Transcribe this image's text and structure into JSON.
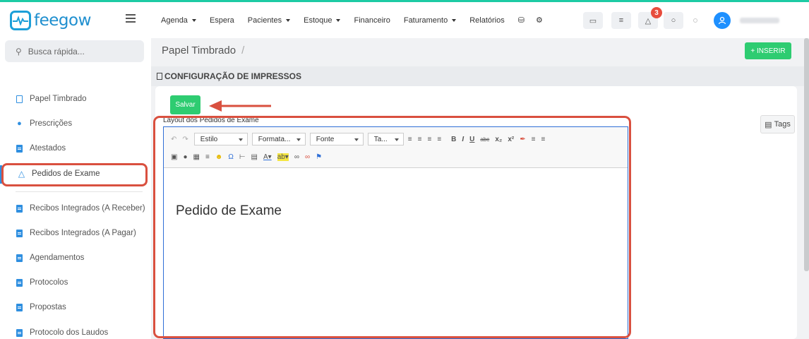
{
  "app": {
    "brand": "feegow"
  },
  "nav": {
    "items": [
      {
        "label": "Agenda",
        "dropdown": true
      },
      {
        "label": "Espera",
        "dropdown": false
      },
      {
        "label": "Pacientes",
        "dropdown": true
      },
      {
        "label": "Estoque",
        "dropdown": true
      },
      {
        "label": "Financeiro",
        "dropdown": false
      },
      {
        "label": "Faturamento",
        "dropdown": true
      },
      {
        "label": "Relatórios",
        "dropdown": false
      }
    ],
    "notification_count": "3"
  },
  "sidebar": {
    "search_placeholder": "Busca rápida...",
    "items": [
      {
        "label": "Papel Timbrado",
        "icon": "document-icon"
      },
      {
        "label": "Prescrições",
        "icon": "pills-icon"
      },
      {
        "label": "Atestados",
        "icon": "document-plus-icon"
      },
      {
        "label": "Pedidos de Exame",
        "icon": "flask-icon"
      },
      {
        "label": "Recibos Integrados (A Receber)",
        "icon": "document-icon"
      },
      {
        "label": "Recibos Integrados (A Pagar)",
        "icon": "document-icon"
      },
      {
        "label": "Agendamentos",
        "icon": "document-icon"
      },
      {
        "label": "Protocolos",
        "icon": "document-icon"
      },
      {
        "label": "Propostas",
        "icon": "document-icon"
      },
      {
        "label": "Protocolo dos Laudos",
        "icon": "document-icon"
      }
    ]
  },
  "main": {
    "breadcrumb": "Papel Timbrado",
    "breadcrumb_sep": "/",
    "insert_label": "+ INSERIR",
    "section_title": "CONFIGURAÇÃO DE IMPRESSOS",
    "save_label": "Salvar",
    "field_label": "Layout dos Pedidos de Exame",
    "tags_label": "Tags",
    "editor": {
      "combos": [
        "Estilo",
        "Formata...",
        "Fonte",
        "Ta..."
      ],
      "content": "Pedido de Exame"
    }
  },
  "colors": {
    "accent": "#2ecc71",
    "brand": "#1f8fcf",
    "highlight": "#d9503f",
    "topline": "#1dcba4"
  }
}
